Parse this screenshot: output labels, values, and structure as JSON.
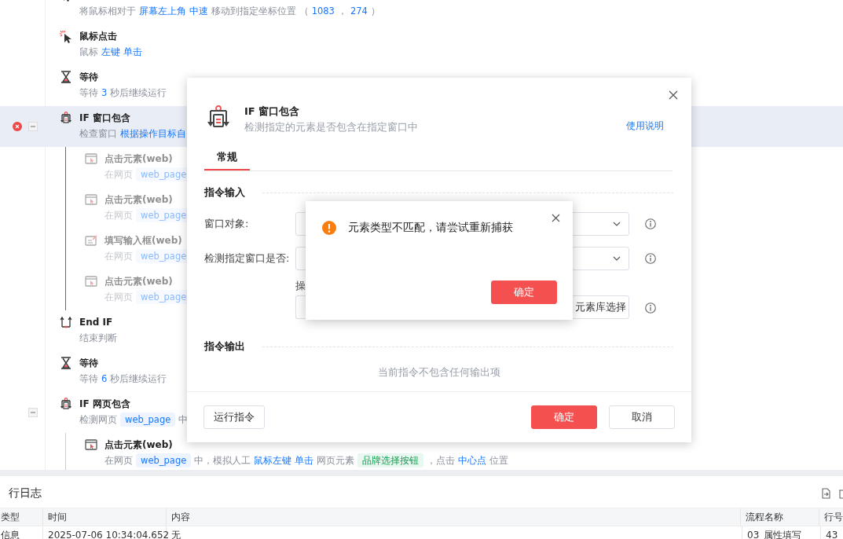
{
  "steps": [
    {
      "kind": "move",
      "desc": [
        {
          "kind": "text",
          "text": "将鼠标相对于"
        },
        {
          "kind": "value",
          "text": "屏幕左上角"
        },
        {
          "kind": "value",
          "text": "中速"
        },
        {
          "kind": "text",
          "text": "移动到指定坐标位置 （"
        },
        {
          "kind": "value",
          "text": "1083"
        },
        {
          "kind": "text",
          "text": "，"
        },
        {
          "kind": "value",
          "text": "274"
        },
        {
          "kind": "text",
          "text": "）"
        }
      ],
      "selected": false,
      "error": false,
      "disabled": false
    },
    {
      "kind": "click",
      "title": "鼠标点击",
      "desc": [
        {
          "kind": "text",
          "text": "鼠标"
        },
        {
          "kind": "value",
          "text": "左键"
        },
        {
          "kind": "value",
          "text": "单击"
        }
      ],
      "selected": false,
      "error": false,
      "disabled": false
    },
    {
      "kind": "wait",
      "title": "等待",
      "desc": [
        {
          "kind": "text",
          "text": "等待"
        },
        {
          "kind": "value",
          "text": "3"
        },
        {
          "kind": "text",
          "text": "秒后继续运行"
        }
      ],
      "selected": false,
      "error": false,
      "disabled": false
    },
    {
      "kind": "if",
      "title": "IF 窗口包含",
      "desc": [
        {
          "kind": "text",
          "text": "检查窗口"
        },
        {
          "kind": "value",
          "text": "根据操作目标自"
        }
      ],
      "selected": true,
      "error": true,
      "disabled": false,
      "expanded": true,
      "children": [
        {
          "kind": "web_click",
          "title": "点击元素(web)",
          "desc": [
            {
              "kind": "text",
              "text": "在网页"
            },
            {
              "kind": "tag",
              "text": "web_page"
            }
          ],
          "selected": false,
          "disabled": true
        },
        {
          "kind": "web_click",
          "title": "点击元素(web)",
          "desc": [
            {
              "kind": "text",
              "text": "在网页"
            },
            {
              "kind": "tag",
              "text": "web_page"
            }
          ],
          "selected": false,
          "disabled": true
        },
        {
          "kind": "web_input",
          "title": "填写输入框(web)",
          "desc": [
            {
              "kind": "text",
              "text": "在网页"
            },
            {
              "kind": "tag",
              "text": "web_page"
            }
          ],
          "selected": false,
          "disabled": true
        },
        {
          "kind": "web_click",
          "title": "点击元素(web)",
          "desc": [
            {
              "kind": "text",
              "text": "在网页"
            },
            {
              "kind": "tag",
              "text": "web_page"
            }
          ],
          "selected": false,
          "disabled": true
        }
      ]
    },
    {
      "kind": "endif",
      "title": "End IF",
      "desc": [
        {
          "kind": "text",
          "text": "结束判断"
        }
      ],
      "selected": false,
      "error": false,
      "disabled": false
    },
    {
      "kind": "wait",
      "title": "等待",
      "desc": [
        {
          "kind": "text",
          "text": "等待"
        },
        {
          "kind": "value",
          "text": "6"
        },
        {
          "kind": "text",
          "text": "秒后继续运行"
        }
      ],
      "selected": false,
      "error": false,
      "disabled": false
    },
    {
      "kind": "if",
      "title": "IF 网页包含",
      "desc": [
        {
          "kind": "text",
          "text": "检测网页"
        },
        {
          "kind": "tag",
          "text": "web_page"
        },
        {
          "kind": "text",
          "text": "中"
        }
      ],
      "selected": false,
      "error": false,
      "disabled": false,
      "expanded": true,
      "children": [
        {
          "kind": "web_click",
          "title": "点击元素(web)",
          "desc": [
            {
              "kind": "text",
              "text": "在网页"
            },
            {
              "kind": "tag",
              "text": "web_page"
            },
            {
              "kind": "text",
              "text": "中，模拟人工"
            },
            {
              "kind": "value",
              "text": "鼠标左键"
            },
            {
              "kind": "value",
              "text": "单击"
            },
            {
              "kind": "text",
              "text": "网页元素"
            },
            {
              "kind": "tag_green",
              "text": "品牌选择按钮"
            },
            {
              "kind": "text",
              "text": "，点击"
            },
            {
              "kind": "value",
              "text": "中心点"
            },
            {
              "kind": "text",
              "text": "位置"
            }
          ],
          "selected": false,
          "disabled": false
        }
      ]
    }
  ],
  "log": {
    "title": "行日志",
    "columns": [
      "类型",
      "时间",
      "内容",
      "流程名称",
      "行号"
    ],
    "rows": [
      [
        "信息",
        "2025-07-06 10:34:04.652",
        "无",
        "03_属性填写",
        "43"
      ]
    ]
  },
  "dialog": {
    "title": "IF 窗口包含",
    "subtitle": "检测指定的元素是否包含在指定窗口中",
    "help": "使用说明",
    "tabs": [
      {
        "label": "常规",
        "selected": true
      }
    ],
    "input_section": "指令输入",
    "fields": [
      {
        "kind": "select",
        "label": "窗口对象:"
      },
      {
        "kind": "select",
        "label": "检测指定窗口是否:"
      },
      {
        "kind": "element",
        "label": "操",
        "button": "元素库选择"
      }
    ],
    "output_section": "指令输出",
    "output_empty": "当前指令不包含任何输出项",
    "run_button": "运行指令",
    "ok_button": "确定",
    "cancel_button": "取消"
  },
  "alert": {
    "message": "元素类型不匹配，请尝试重新捕获",
    "button": "确定"
  }
}
